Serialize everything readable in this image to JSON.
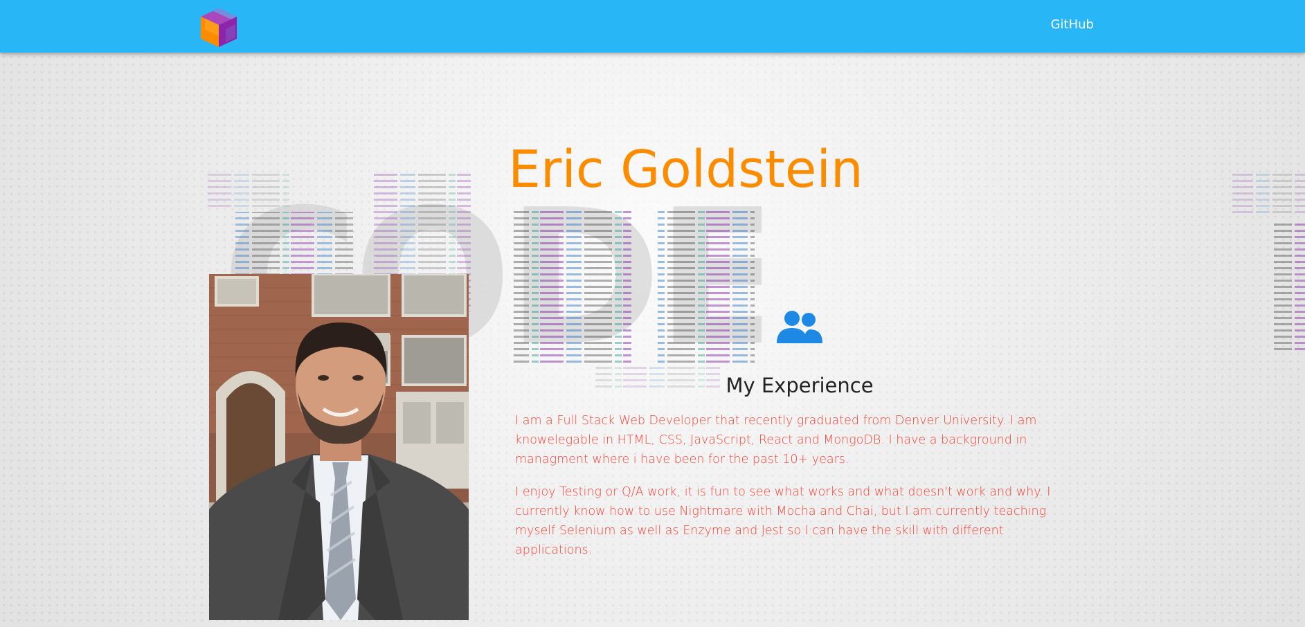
{
  "navbar": {
    "logo_icon": "cube-logo-icon",
    "links": [
      {
        "label": "GitHub"
      }
    ],
    "background": "#29b6f6"
  },
  "hero": {
    "title": "Eric Goldstein",
    "title_color": "#fb8c00",
    "background_art_icon": "code-word-art"
  },
  "profile": {
    "photo_icon": "portrait-photo"
  },
  "experience": {
    "icon": "people-icon",
    "icon_color": "#1e88e5",
    "heading": "My Experience",
    "paragraphs": [
      "I am a Full Stack Web Developer that recently graduated from Denver University. I am knowelegable in HTML, CSS, JavaScript, React and MongoDB. I have a background in managment where i have been for the past 10+ years.",
      "I enjoy Testing or Q/A work, it is fun to see what works and what doesn't work and why. I currently know how to use Nightmare with Mocha and Chai, but I am currently teaching myself Selenium as well as Enzyme and Jest so I can have the skill with different applications."
    ],
    "text_color": "#f44336"
  }
}
